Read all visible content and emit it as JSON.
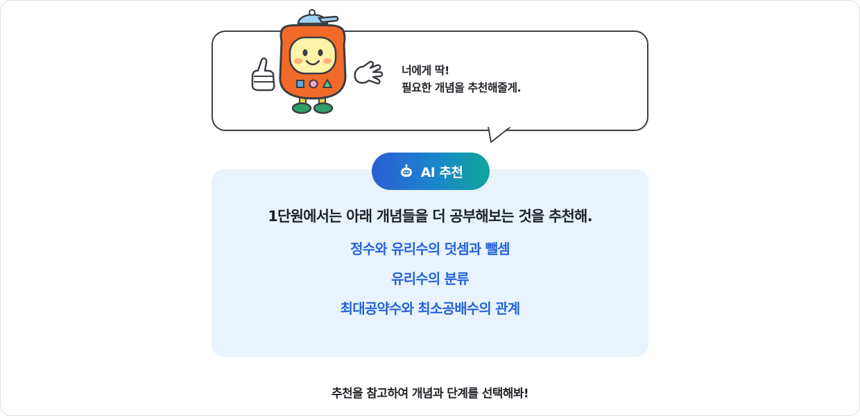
{
  "speech": {
    "line1": "너에게 딱!",
    "line2": "필요한 개념을 추천해줄게."
  },
  "badge": {
    "label": "AI 추천",
    "icon": "robot-icon"
  },
  "recommendation": {
    "lead": "1단원에서는 아래 개념들을 더 공부해보는 것을 추천해.",
    "concepts": [
      "정수와 유리수의 덧셈과 뺄셈",
      "유리수의 분류",
      "최대공약수와 최소공배수의 관계"
    ]
  },
  "footer": {
    "text": "추천을 참고하여 개념과 단계를 선택해봐!"
  },
  "colors": {
    "concept_blue": "#2563d8",
    "panel_bg": "#e8f3fd",
    "badge_gradient_start": "#2b5fd6",
    "badge_gradient_end": "#10a79b",
    "mascot_orange": "#f26a2a"
  }
}
